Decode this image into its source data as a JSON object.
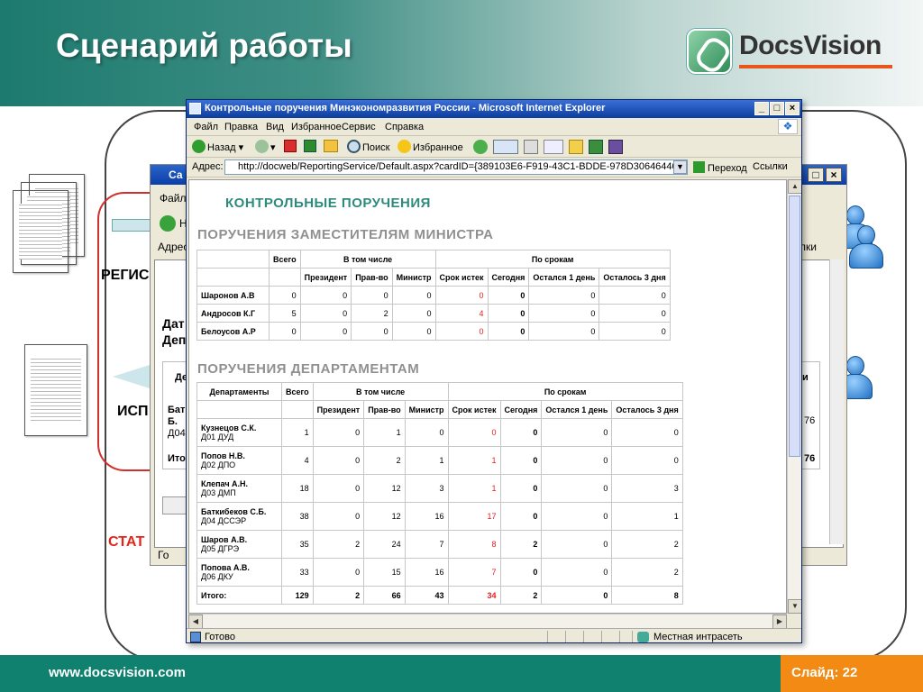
{
  "slide": {
    "title": "Сценарий работы",
    "logo_text": "DocsVision",
    "footer_url": "www.docsvision.com",
    "slide_number": "Слайд: 22",
    "labels": {
      "reg": "РЕГИС",
      "isp": "ИСП",
      "stat": "СТАТ"
    },
    "colors": {
      "header": "#1d7a6e",
      "footer": "#10806f",
      "accent": "#f28a14",
      "label_red": "#e1261c"
    }
  },
  "back_window": {
    "title": "Са",
    "menu_file": "Файл",
    "nav_label": "Н",
    "address_label": "Адрес",
    "links_label": "лки",
    "heading_line1": "Дат",
    "heading_line2": "Деп",
    "col_de": "Де",
    "col_right": "и",
    "row1": "Бат",
    "row1b": "Б.",
    "row1c": "Д04",
    "row1_val": "76",
    "total": "Ито",
    "total_val": "76",
    "status": "Го"
  },
  "window": {
    "title": "Контрольные поручения Минэкономразвития России - Microsoft Internet Explorer",
    "menu": [
      "Файл",
      "Правка",
      "Вид",
      "Избранное",
      "Сервис",
      "Справка"
    ],
    "toolbar": {
      "back": "Назад",
      "search": "Поиск",
      "favorites": "Избранное"
    },
    "address_label": "Адрес:",
    "address": "http://docweb/ReportingService/Default.aspx?cardID={389103E6-F919-43C1-BDDE-978D30646440}&rid=58",
    "go": "Переход",
    "links": "Ссылки",
    "status": "Готово",
    "zone": "Местная интрасеть"
  },
  "report": {
    "title": "КОНТРОЛЬНЫЕ ПОРУЧЕНИЯ",
    "section1": "ПОРУЧЕНИЯ ЗАМЕСТИТЕЛЯМ МИНИСТРА",
    "section2": "ПОРУЧЕНИЯ ДЕПАРТАМЕНТАМ",
    "headers": {
      "total": "Всего",
      "including": "В том числе",
      "by_term": "По срокам",
      "departments": "Департаменты",
      "sub": [
        "Президент",
        "Прав-во",
        "Министр",
        "Срок истек",
        "Сегодня",
        "Остался 1 день",
        "Осталось 3 дня"
      ]
    },
    "deputies": [
      {
        "name": "Шаронов А.В",
        "v": [
          "0",
          "0",
          "0",
          "0",
          "0",
          "0",
          "0",
          "0"
        ]
      },
      {
        "name": "Андросов К.Г",
        "v": [
          "5",
          "0",
          "2",
          "0",
          "4",
          "0",
          "0",
          "0"
        ]
      },
      {
        "name": "Белоусов А.Р",
        "v": [
          "0",
          "0",
          "0",
          "0",
          "0",
          "0",
          "0",
          "0"
        ]
      }
    ],
    "departments": [
      {
        "name": "Кузнецов С.К.",
        "dept": "Д01 ДУД",
        "v": [
          "1",
          "0",
          "1",
          "0",
          "0",
          "0",
          "0",
          "0"
        ]
      },
      {
        "name": "Попов Н.В.",
        "dept": "Д02 ДПО",
        "v": [
          "4",
          "0",
          "2",
          "1",
          "1",
          "0",
          "0",
          "0"
        ]
      },
      {
        "name": "Клепач А.Н.",
        "dept": "Д03 ДМП",
        "v": [
          "18",
          "0",
          "12",
          "3",
          "1",
          "0",
          "0",
          "3"
        ]
      },
      {
        "name": "Баткибеков С.Б.",
        "dept": "Д04 ДССЭР",
        "v": [
          "38",
          "0",
          "12",
          "16",
          "17",
          "0",
          "0",
          "1"
        ]
      },
      {
        "name": "Шаров А.В.",
        "dept": "Д05 ДГРЭ",
        "v": [
          "35",
          "2",
          "24",
          "7",
          "8",
          "2",
          "0",
          "2"
        ]
      },
      {
        "name": "Попова А.В.",
        "dept": "Д06 ДКУ",
        "v": [
          "33",
          "0",
          "15",
          "16",
          "7",
          "0",
          "0",
          "2"
        ]
      }
    ],
    "total_label": "Итого:",
    "totals": [
      "129",
      "2",
      "66",
      "43",
      "34",
      "2",
      "0",
      "8"
    ]
  }
}
